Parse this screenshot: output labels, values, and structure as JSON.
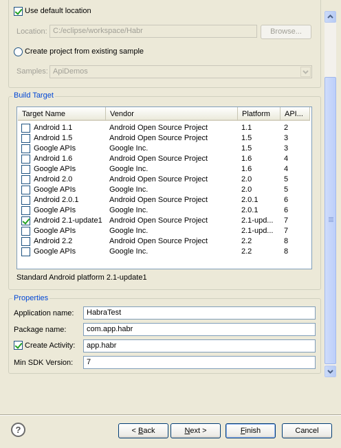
{
  "location": {
    "use_default_label": "Use default location",
    "label": "Location:",
    "value": "C:/eclipse/workspace/Habr",
    "browse_label": "Browse..."
  },
  "sample": {
    "radio_label": "Create project from existing sample",
    "samples_label": "Samples:",
    "samples_value": "ApiDemos"
  },
  "build_target": {
    "title": "Build Target",
    "columns": [
      "Target Name",
      "Vendor",
      "Platform",
      "API..."
    ],
    "rows": [
      {
        "name": "Android 1.1",
        "vendor": "Android Open Source Project",
        "platform": "1.1",
        "api": "2",
        "checked": false
      },
      {
        "name": "Android 1.5",
        "vendor": "Android Open Source Project",
        "platform": "1.5",
        "api": "3",
        "checked": false
      },
      {
        "name": "Google APIs",
        "vendor": "Google Inc.",
        "platform": "1.5",
        "api": "3",
        "checked": false
      },
      {
        "name": "Android 1.6",
        "vendor": "Android Open Source Project",
        "platform": "1.6",
        "api": "4",
        "checked": false
      },
      {
        "name": "Google APIs",
        "vendor": "Google Inc.",
        "platform": "1.6",
        "api": "4",
        "checked": false
      },
      {
        "name": "Android 2.0",
        "vendor": "Android Open Source Project",
        "platform": "2.0",
        "api": "5",
        "checked": false
      },
      {
        "name": "Google APIs",
        "vendor": "Google Inc.",
        "platform": "2.0",
        "api": "5",
        "checked": false
      },
      {
        "name": "Android 2.0.1",
        "vendor": "Android Open Source Project",
        "platform": "2.0.1",
        "api": "6",
        "checked": false
      },
      {
        "name": "Google APIs",
        "vendor": "Google Inc.",
        "platform": "2.0.1",
        "api": "6",
        "checked": false
      },
      {
        "name": "Android 2.1-update1",
        "vendor": "Android Open Source Project",
        "platform": "2.1-upd...",
        "api": "7",
        "checked": true
      },
      {
        "name": "Google APIs",
        "vendor": "Google Inc.",
        "platform": "2.1-upd...",
        "api": "7",
        "checked": false
      },
      {
        "name": "Android 2.2",
        "vendor": "Android Open Source Project",
        "platform": "2.2",
        "api": "8",
        "checked": false
      },
      {
        "name": "Google APIs",
        "vendor": "Google Inc.",
        "platform": "2.2",
        "api": "8",
        "checked": false
      }
    ],
    "description": "Standard Android platform 2.1-update1"
  },
  "properties": {
    "title": "Properties",
    "app_name_label": "Application name:",
    "app_name_value": "HabraTest",
    "package_label": "Package name:",
    "package_value": "com.app.habr",
    "create_activity_label": "Create Activity:",
    "activity_value": "app.habr",
    "min_sdk_label": "Min SDK Version:",
    "min_sdk_value": "7"
  },
  "buttons": {
    "back_pre": "< ",
    "back_key": "B",
    "back_post": "ack",
    "next_key": "N",
    "next_post": "ext >",
    "finish_key": "F",
    "finish_post": "inish",
    "cancel": "Cancel"
  },
  "icons": {
    "help": "help-icon",
    "scroll_up": "scroll-up-arrow-icon",
    "scroll_down": "scroll-down-arrow-icon",
    "combo": "chevron-down-icon"
  }
}
